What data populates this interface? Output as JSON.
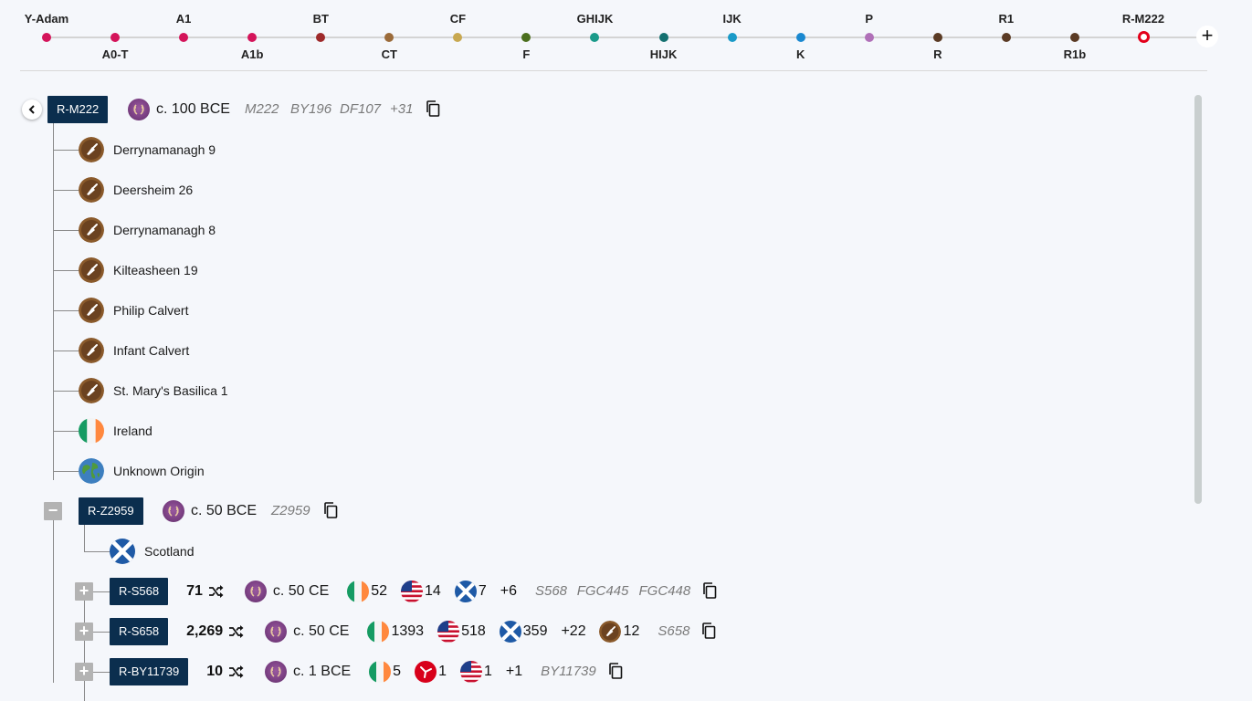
{
  "timeline": {
    "nodes": [
      {
        "label": "Y-Adam",
        "color": "#d4145a",
        "pos": "top"
      },
      {
        "label": "A0-T",
        "color": "#d4145a",
        "pos": "bottom"
      },
      {
        "label": "A1",
        "color": "#d4145a",
        "pos": "top"
      },
      {
        "label": "A1b",
        "color": "#d4145a",
        "pos": "bottom"
      },
      {
        "label": "BT",
        "color": "#9e2a2b",
        "pos": "top"
      },
      {
        "label": "CT",
        "color": "#9b6b3a",
        "pos": "bottom"
      },
      {
        "label": "CF",
        "color": "#c8a850",
        "pos": "top"
      },
      {
        "label": "F",
        "color": "#4b6f1e",
        "pos": "bottom"
      },
      {
        "label": "GHIJK",
        "color": "#1a9a8a",
        "pos": "top"
      },
      {
        "label": "HIJK",
        "color": "#147070",
        "pos": "bottom"
      },
      {
        "label": "IJK",
        "color": "#1a9ac8",
        "pos": "top"
      },
      {
        "label": "K",
        "color": "#1a88d0",
        "pos": "bottom"
      },
      {
        "label": "P",
        "color": "#b070b8",
        "pos": "top"
      },
      {
        "label": "R",
        "color": "#5a3a24",
        "pos": "bottom"
      },
      {
        "label": "R1",
        "color": "#5a3a24",
        "pos": "top"
      },
      {
        "label": "R1b",
        "color": "#5a3a24",
        "pos": "bottom"
      },
      {
        "label": "R-M222",
        "color": "#e3001b",
        "pos": "top",
        "current": true
      }
    ],
    "plus_label": "+"
  },
  "root": {
    "haplogroup": "R-M222",
    "age": "c. 100 BCE",
    "snps": [
      "M222",
      "BY196",
      "DF107",
      "+31"
    ]
  },
  "leaves": [
    {
      "label": "Derrynamanagh 9",
      "icon": "trowel-icon"
    },
    {
      "label": "Deersheim 26",
      "icon": "trowel-icon"
    },
    {
      "label": "Derrynamanagh 8",
      "icon": "trowel-icon"
    },
    {
      "label": "Kilteasheen 19",
      "icon": "trowel-icon"
    },
    {
      "label": "Philip Calvert",
      "icon": "trowel-icon"
    },
    {
      "label": "Infant Calvert",
      "icon": "trowel-icon"
    },
    {
      "label": "St. Mary's Basilica 1",
      "icon": "trowel-icon"
    },
    {
      "label": "Ireland",
      "icon": "ireland-flag-icon"
    },
    {
      "label": "Unknown Origin",
      "icon": "globe-icon"
    }
  ],
  "z2959": {
    "haplogroup": "R-Z2959",
    "toggle": "−",
    "age": "c. 50 BCE",
    "snps": [
      "Z2959"
    ],
    "leaf": {
      "label": "Scotland",
      "icon": "scotland-flag-icon"
    }
  },
  "subclades": [
    {
      "haplogroup": "R-S568",
      "toggle": "+",
      "count": "71",
      "age": "c. 50 CE",
      "flags": [
        {
          "icon": "ireland-flag-icon",
          "num": "52"
        },
        {
          "icon": "usa-flag-icon",
          "num": "14"
        },
        {
          "icon": "scotland-flag-icon",
          "num": "7"
        }
      ],
      "more": "+6",
      "snps": [
        "S568",
        "FGC445",
        "FGC448"
      ]
    },
    {
      "haplogroup": "R-S658",
      "toggle": "+",
      "count": "2,269",
      "age": "c. 50 CE",
      "flags": [
        {
          "icon": "ireland-flag-icon",
          "num": "1393"
        },
        {
          "icon": "usa-flag-icon",
          "num": "518"
        },
        {
          "icon": "scotland-flag-icon",
          "num": "359"
        }
      ],
      "more": "+22",
      "ancient": {
        "icon": "trowel-icon",
        "num": "12"
      },
      "snps": [
        "S658"
      ]
    },
    {
      "haplogroup": "R-BY11739",
      "toggle": "+",
      "count": "10",
      "age": "c. 1 BCE",
      "flags": [
        {
          "icon": "ireland-flag-icon",
          "num": "5"
        },
        {
          "icon": "isle-of-man-flag-icon",
          "num": "1"
        },
        {
          "icon": "usa-flag-icon",
          "num": "1"
        }
      ],
      "more": "+1",
      "snps": [
        "BY11739"
      ]
    }
  ]
}
